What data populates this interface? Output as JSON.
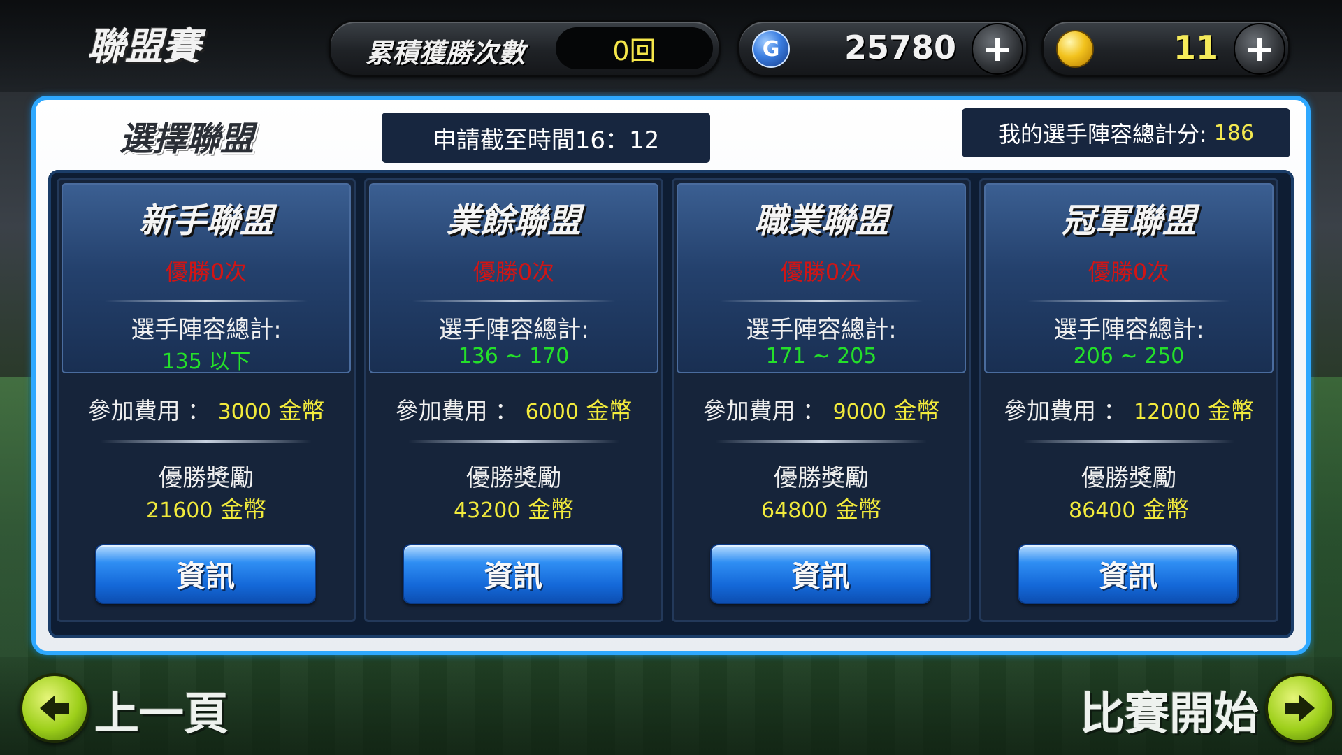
{
  "header": {
    "title": "聯盟賽",
    "wins_label": "累積獲勝次數",
    "wins_value": "0回",
    "g_value": "25780",
    "coin_value": "11",
    "plus_symbol": "+",
    "g_icon_letter": "G"
  },
  "panel": {
    "title": "選擇聯盟",
    "deadline": "申請截至時間16：12",
    "my_score_label": "我的選手陣容總計分:",
    "my_score_value": "186"
  },
  "leagues": [
    {
      "name": "新手聯盟",
      "wins": "優勝0次",
      "range_label": "選手陣容總計:",
      "range_value": "135 以下",
      "fee_label": "參加費用 ：",
      "fee_value": "3000",
      "fee_unit": "金幣",
      "prize_label": "優勝獎勵",
      "prize_value": "21600",
      "prize_unit": "金幣",
      "button_label": "資訊"
    },
    {
      "name": "業餘聯盟",
      "wins": "優勝0次",
      "range_label": "選手陣容總計:",
      "range_value": "136 ~ 170",
      "fee_label": "參加費用 ：",
      "fee_value": "6000",
      "fee_unit": "金幣",
      "prize_label": "優勝獎勵",
      "prize_value": "43200",
      "prize_unit": "金幣",
      "button_label": "資訊"
    },
    {
      "name": "職業聯盟",
      "wins": "優勝0次",
      "range_label": "選手陣容總計:",
      "range_value": "171 ~ 205",
      "fee_label": "參加費用 ：",
      "fee_value": "9000",
      "fee_unit": "金幣",
      "prize_label": "優勝獎勵",
      "prize_value": "64800",
      "prize_unit": "金幣",
      "button_label": "資訊"
    },
    {
      "name": "冠軍聯盟",
      "wins": "優勝0次",
      "range_label": "選手陣容總計:",
      "range_value": "206 ~ 250",
      "fee_label": "參加費用 ：",
      "fee_value": "12000",
      "fee_unit": "金幣",
      "prize_label": "優勝獎勵",
      "prize_value": "86400",
      "prize_unit": "金幣",
      "button_label": "資訊"
    }
  ],
  "nav": {
    "back_label": "上一頁",
    "start_label": "比賽開始"
  },
  "colors": {
    "accent_blue": "#2ea8ff",
    "win_red": "#d01515",
    "range_green": "#24e02a",
    "gold_yellow": "#f1ea3c",
    "arrow_green": "#9dcf1a"
  },
  "icons": {
    "gold_currency": "g-coin-icon",
    "ball_currency": "baseball-icon",
    "back": "arrow-left-icon",
    "start": "arrow-right-icon"
  }
}
